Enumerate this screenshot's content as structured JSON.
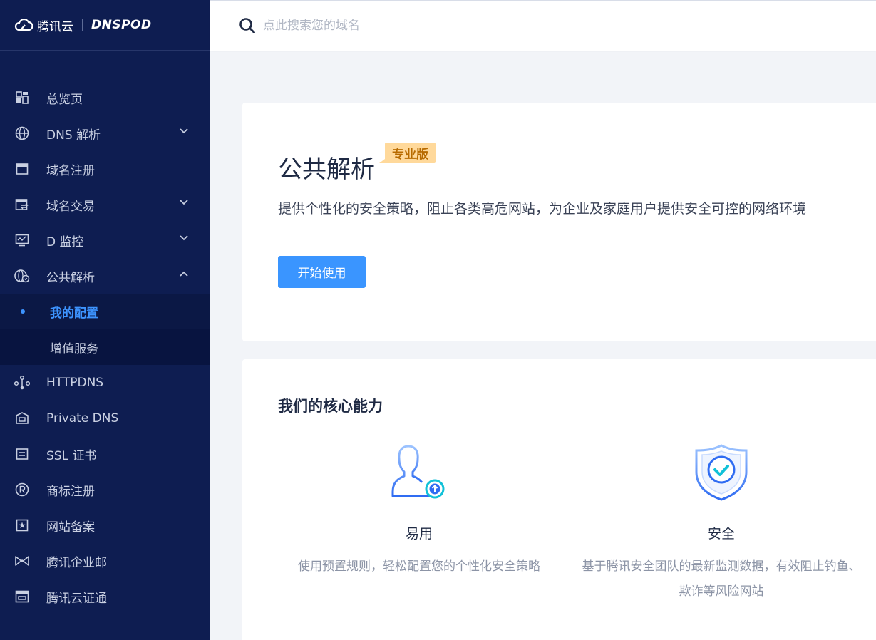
{
  "brand": {
    "name": "腾讯云",
    "product": "DNSPOD"
  },
  "search": {
    "placeholder": "点此搜索您的域名"
  },
  "sidebar": {
    "items": [
      {
        "label": "总览页",
        "icon": "dashboard-icon"
      },
      {
        "label": "DNS 解析",
        "icon": "globe-icon",
        "chevron": "down"
      },
      {
        "label": "域名注册",
        "icon": "browser-window-icon"
      },
      {
        "label": "域名交易",
        "icon": "domain-trade-icon",
        "chevron": "down"
      },
      {
        "label": "D 监控",
        "icon": "monitor-icon",
        "chevron": "down"
      },
      {
        "label": "公共解析",
        "icon": "public-dns-icon",
        "chevron": "up"
      }
    ],
    "sub_items": [
      {
        "label": "我的配置",
        "active": true
      },
      {
        "label": "增值服务",
        "active": false
      }
    ],
    "items_after": [
      {
        "label": "HTTPDNS",
        "icon": "httpdns-icon"
      },
      {
        "label": "Private DNS",
        "icon": "private-dns-icon"
      },
      {
        "label": "SSL 证书",
        "icon": "ssl-certificate-icon"
      },
      {
        "label": "商标注册",
        "icon": "registered-trademark-icon"
      },
      {
        "label": "网站备案",
        "icon": "website-filing-icon"
      },
      {
        "label": "腾讯企业邮",
        "icon": "enterprise-mail-icon"
      },
      {
        "label": "腾讯云证通",
        "icon": "certificate-icon"
      }
    ]
  },
  "hero": {
    "title": "公共解析",
    "badge": "专业版",
    "description": "提供个性化的安全策略，阻止各类高危网站，为企业及家庭用户提供安全可控的网络环境",
    "button": "开始使用"
  },
  "core": {
    "title": "我们的核心能力",
    "features": [
      {
        "name": "易用",
        "description": "使用预置规则，轻松配置您的个性化安全策略",
        "icon": "user-upgrade-icon"
      },
      {
        "name": "安全",
        "description": "基于腾讯安全团队的最新监测数据，有效阻止钓鱼、欺诈等风险网站",
        "icon": "shield-check-icon"
      }
    ]
  },
  "colors": {
    "sidebar_bg": "#0e1d51",
    "accent": "#3a95ff",
    "badge_bg": "#ffd99b",
    "badge_text": "#b86b00"
  }
}
